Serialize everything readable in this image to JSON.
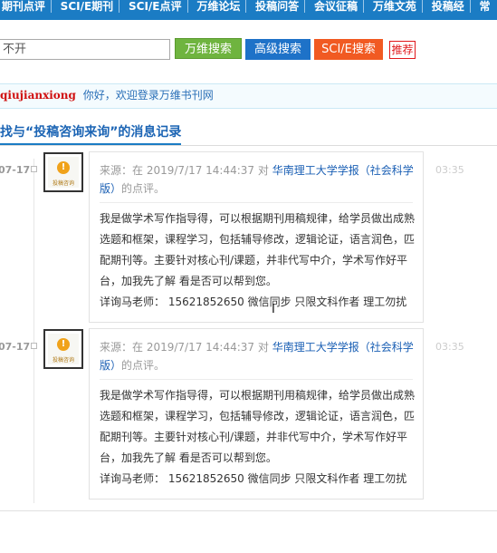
{
  "topnav": {
    "items": [
      "期刊点评",
      "SCI/E期刊",
      "SCI/E点评",
      "万维论坛",
      "投稿问答",
      "会议征稿",
      "万维文苑",
      "投稿经",
      "常"
    ]
  },
  "search": {
    "value": "不开",
    "buttons": {
      "wanwei": "万维搜索",
      "advanced": "高级搜索",
      "sci": "SCI/E搜索",
      "recommend": "推荐"
    }
  },
  "welcome": {
    "username": "qiujianxiong",
    "text": "你好，欢迎登录万维书刊网"
  },
  "page": {
    "title": "找与“投稿咨询来询”的消息记录"
  },
  "messages": [
    {
      "date": "07-17",
      "source_prefix": "来源：在 2019/7/17 14:44:37 对",
      "journal": "华南理工大学学报（社会科学版）",
      "source_suffix": "的点评。",
      "content": "我是做学术写作指导得，可以根据期刊用稿规律，给学员做出成熟选题和框架，课程学习，包括辅导修改，逻辑论证，语言润色，匹配期刊等。主要针对核心刊/课题，并非代写中介，学术写作好平台，加我先了解 看是否可以帮到您。",
      "contact": "详询马老师： 15621852650 微信同步 只限文科作者 理工勿扰",
      "time": "03:35",
      "avatar_label": "投稿咨询"
    },
    {
      "date": "07-17",
      "source_prefix": "来源：在 2019/7/17 14:44:37 对",
      "journal": "华南理工大学学报（社会科学版）",
      "source_suffix": "的点评。",
      "content": "我是做学术写作指导得，可以根据期刊用稿规律，给学员做出成熟选题和框架，课程学习，包括辅导修改，逻辑论证，语言润色，匹配期刊等。主要针对核心刊/课题，并非代写中介，学术写作好平台，加我先了解 看是否可以帮到您。",
      "contact": "详询马老师： 15621852650 微信同步 只限文科作者 理工勿扰",
      "time": "03:35",
      "avatar_label": "投稿咨询"
    }
  ],
  "colors": {
    "nav_bg": "#1b7cc4",
    "wanwei_btn": "#6fb43f",
    "advanced_btn": "#1e72c8",
    "sci_btn": "#f15a22",
    "recommend": "#e0181b",
    "journal_link": "#1a5fb4"
  }
}
